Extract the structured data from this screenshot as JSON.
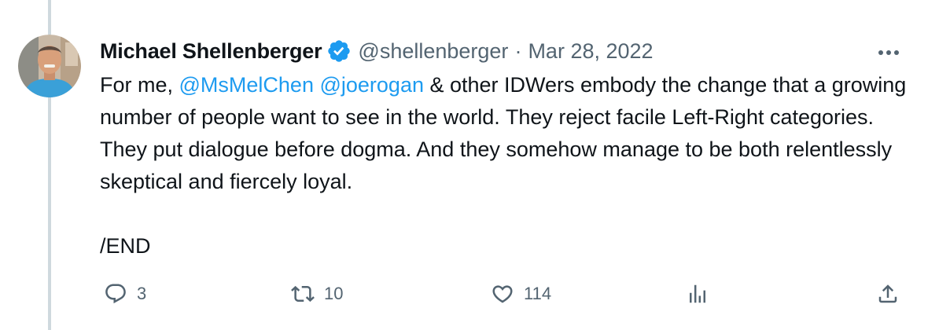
{
  "tweet": {
    "author": {
      "display_name": "Michael Shellenberger",
      "handle": "@shellenberger",
      "verified_color": "#1d9bf0"
    },
    "separator": "·",
    "date": "Mar 28, 2022",
    "more_icon": "more-horizontal-icon",
    "body": {
      "line1_prefix": "For me, ",
      "mention1": "@MsMelChen",
      "space": " ",
      "mention2": "@joerogan",
      "line1_suffix": " & other IDWers embody the change that a growing number of people want to see in the world. They reject facile Left-Right categories. They put dialogue before dogma. And they somehow manage to be both relentlessly skeptical and fiercely loyal.",
      "end": "/END"
    },
    "actions": {
      "reply_count": "3",
      "retweet_count": "10",
      "like_count": "114"
    }
  },
  "colors": {
    "text": "#0f1419",
    "muted": "#536471",
    "link": "#1d9bf0",
    "thread_line": "#cfd9de"
  }
}
